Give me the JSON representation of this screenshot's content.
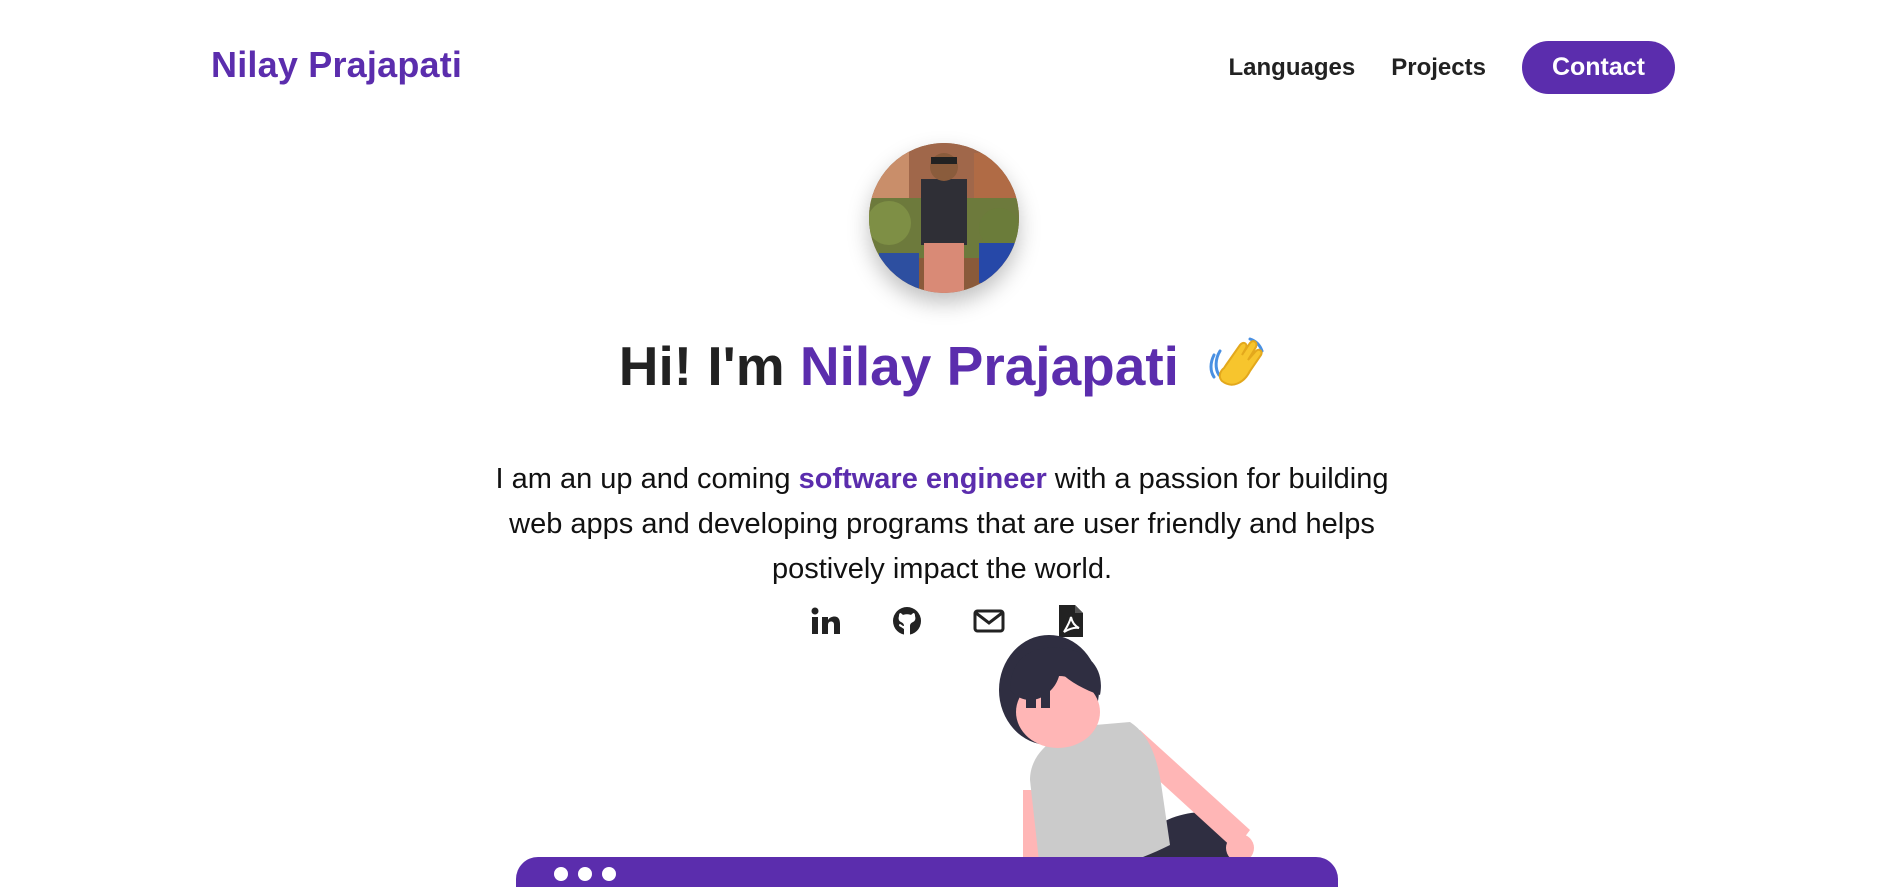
{
  "header": {
    "brand": "Nilay Prajapati",
    "nav": {
      "languages": "Languages",
      "projects": "Projects",
      "contact": "Contact"
    }
  },
  "hero": {
    "title_prefix": "Hi! I'm ",
    "title_name": "Nilay Prajapati",
    "intro_part1": "I am an up and coming ",
    "intro_highlight": "software engineer",
    "intro_part2": " with a passion for building web apps and developing programs that are user friendly and helps postively impact the world."
  },
  "social": {
    "icons": [
      "linkedin-icon",
      "github-icon",
      "email-icon",
      "pdf-resume-icon"
    ]
  },
  "colors": {
    "accent": "#5b2dad",
    "text": "#222222"
  }
}
